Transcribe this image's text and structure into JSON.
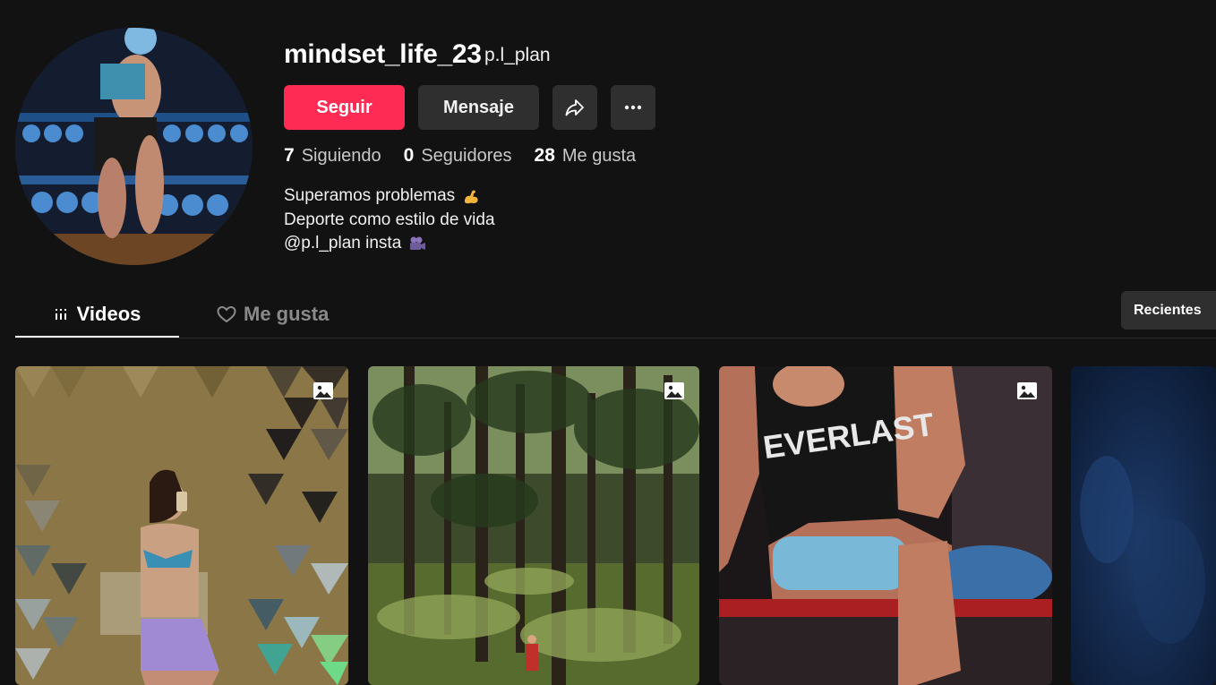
{
  "profile": {
    "username": "mindset_life_23",
    "nickname": "p.l_plan",
    "avatar_icon": "profile-avatar-photo"
  },
  "actions": {
    "follow_label": "Seguir",
    "message_label": "Mensaje",
    "share_icon": "share-icon",
    "more_icon": "more-options-icon"
  },
  "stats": [
    {
      "value": "7",
      "label": "Siguiendo"
    },
    {
      "value": "0",
      "label": "Seguidores"
    },
    {
      "value": "28",
      "label": "Me gusta"
    }
  ],
  "bio": {
    "line1": "Superamos problemas",
    "line1_emoji": "flexed-biceps-emoji",
    "line2": "Deporte como estilo de vida",
    "line3": "@p.l_plan insta",
    "line3_emoji": "movie-camera-emoji"
  },
  "tabs": [
    {
      "label": "Videos",
      "icon": "grid-icon",
      "active": true
    },
    {
      "label": "Me gusta",
      "icon": "heart-icon",
      "active": false
    }
  ],
  "sort": {
    "label": "Recientes"
  },
  "videos": [
    {
      "type": "photo",
      "badge_icon": "photo-post-icon"
    },
    {
      "type": "photo",
      "badge_icon": "photo-post-icon"
    },
    {
      "type": "photo",
      "badge_icon": "photo-post-icon"
    },
    {
      "type": "video"
    }
  ],
  "colors": {
    "background": "#121212",
    "primary": "#fe2c55",
    "secondary_button": "#2f2f2f",
    "muted_text": "#8a8a8a"
  }
}
